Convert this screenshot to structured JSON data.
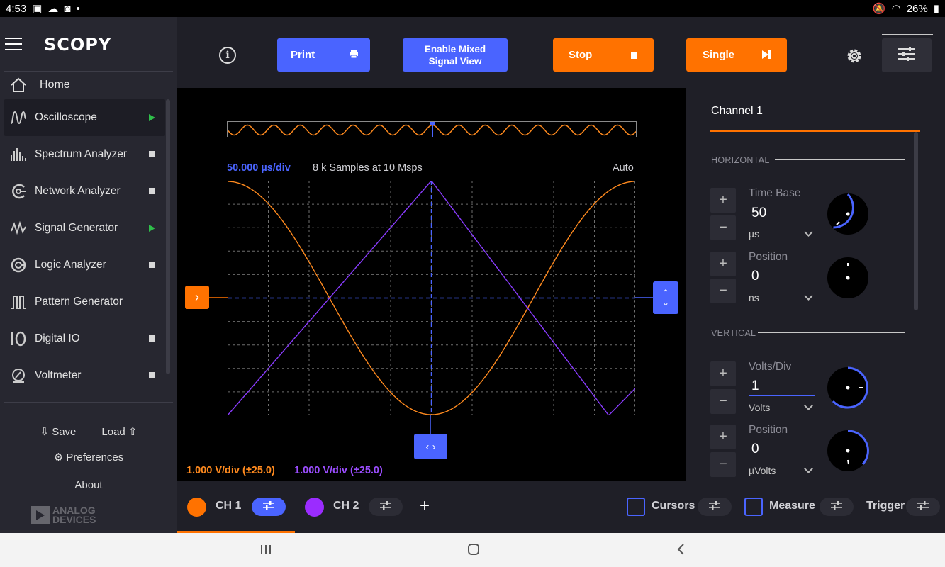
{
  "status_bar": {
    "time": "4:53",
    "battery": "26%"
  },
  "sidebar": {
    "app_name": "SCOPY",
    "home_label": "Home",
    "tools": [
      {
        "label": "Oscilloscope",
        "icon": "oscilloscope-icon",
        "state": "running"
      },
      {
        "label": "Spectrum Analyzer",
        "icon": "spectrum-analyzer-icon",
        "state": "stopped"
      },
      {
        "label": "Network Analyzer",
        "icon": "network-analyzer-icon",
        "state": "stopped"
      },
      {
        "label": "Signal Generator",
        "icon": "signal-generator-icon",
        "state": "running"
      },
      {
        "label": "Logic Analyzer",
        "icon": "logic-analyzer-icon",
        "state": "stopped"
      },
      {
        "label": "Pattern Generator",
        "icon": "pattern-generator-icon",
        "state": "none"
      },
      {
        "label": "Digital IO",
        "icon": "digital-io-icon",
        "state": "stopped"
      },
      {
        "label": "Voltmeter",
        "icon": "voltmeter-icon",
        "state": "stopped"
      }
    ],
    "save_label": "Save",
    "load_label": "Load",
    "preferences_label": "Preferences",
    "about_label": "About",
    "brand_line1": "ANALOG",
    "brand_line2": "DEVICES"
  },
  "toolbar": {
    "print_label": "Print",
    "mixed_label_1": "Enable Mixed",
    "mixed_label_2": "Signal View",
    "stop_label": "Stop",
    "single_label": "Single"
  },
  "plot": {
    "time_div": "50.000 µs/div",
    "samples": "8 k Samples at 10 Msps",
    "trigger_mode": "Auto",
    "ch1_vdiv": "1.000 V/div (±25.0)",
    "ch2_vdiv": "1.000 V/div (±25.0)"
  },
  "right_panel": {
    "title": "Channel 1",
    "horizontal_label": "HORIZONTAL",
    "time_base_label": "Time Base",
    "time_base_value": "50",
    "time_base_unit": "µs",
    "h_position_label": "Position",
    "h_position_value": "0",
    "h_position_unit": "ns",
    "vertical_label": "VERTICAL",
    "volts_div_label": "Volts/Div",
    "volts_div_value": "1",
    "volts_div_unit": "Volts",
    "v_position_label": "Position",
    "v_position_value": "0",
    "v_position_unit": "µVolts",
    "plus": "+",
    "minus": "−"
  },
  "channel_bar": {
    "ch1_label": "CH 1",
    "ch2_label": "CH 2",
    "add_label": "+",
    "cursors_label": "Cursors",
    "measure_label": "Measure",
    "trigger_label": "Trigger"
  },
  "colors": {
    "accent_blue": "#4a64ff",
    "accent_orange": "#ff7200",
    "ch1": "#ff8a1e",
    "ch2": "#9b2cff",
    "panel_bg": "#1f1f27"
  }
}
